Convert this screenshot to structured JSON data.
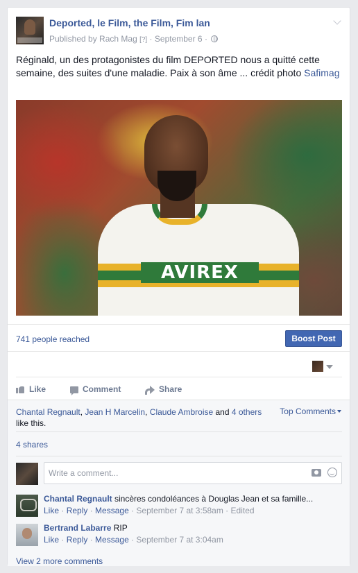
{
  "post": {
    "page_name": "Deported, le Film, the Film, Fim lan",
    "published_by_prefix": "Published by ",
    "publisher": "Rach Mag",
    "help_marker": "[?]",
    "separator": " · ",
    "date": "September 6",
    "separator2": " · ",
    "privacy_icon": "globe-icon",
    "text": "Réginald, un des protagonistes du film DEPORTED nous a quitté cette semaine, des suites d'une maladie. Paix à son âme ... crédit photo ",
    "photo_credit_link": "Safimag",
    "photo_shirt_text": "AVIREX"
  },
  "reach": {
    "text": "741 people reached",
    "boost_label": "Boost Post"
  },
  "actions": {
    "like": "Like",
    "comment": "Comment",
    "share": "Share"
  },
  "likes": {
    "name1": "Chantal Regnault",
    "sep1": ", ",
    "name2": "Jean H Marcelin",
    "sep2": ", ",
    "name3": "Claude Ambroise",
    "and": " and ",
    "others": "4 others",
    "suffix": " like this.",
    "top_comments": "Top Comments"
  },
  "shares": "4 shares",
  "composer": {
    "placeholder": "Write a comment..."
  },
  "comments": [
    {
      "author": "Chantal Regnault",
      "text": " sincères condoléances à Douglas Jean et sa famille...",
      "like": "Like",
      "dot1": " · ",
      "reply": "Reply",
      "dot2": " · ",
      "message": "Message",
      "dot3": " · ",
      "time": "September 7 at 3:58am",
      "dot4": " · ",
      "edited": "Edited"
    },
    {
      "author": "Bertrand Labarre",
      "text": " RIP",
      "like": "Like",
      "dot1": " · ",
      "reply": "Reply",
      "dot2": " · ",
      "message": "Message",
      "dot3": " · ",
      "time": "September 7 at 3:04am"
    }
  ],
  "view_more": "View 2 more comments",
  "colors": {
    "link": "#3b5998",
    "boost": "#4267b2",
    "meta": "#9197a3",
    "background": "#e9eaed"
  }
}
